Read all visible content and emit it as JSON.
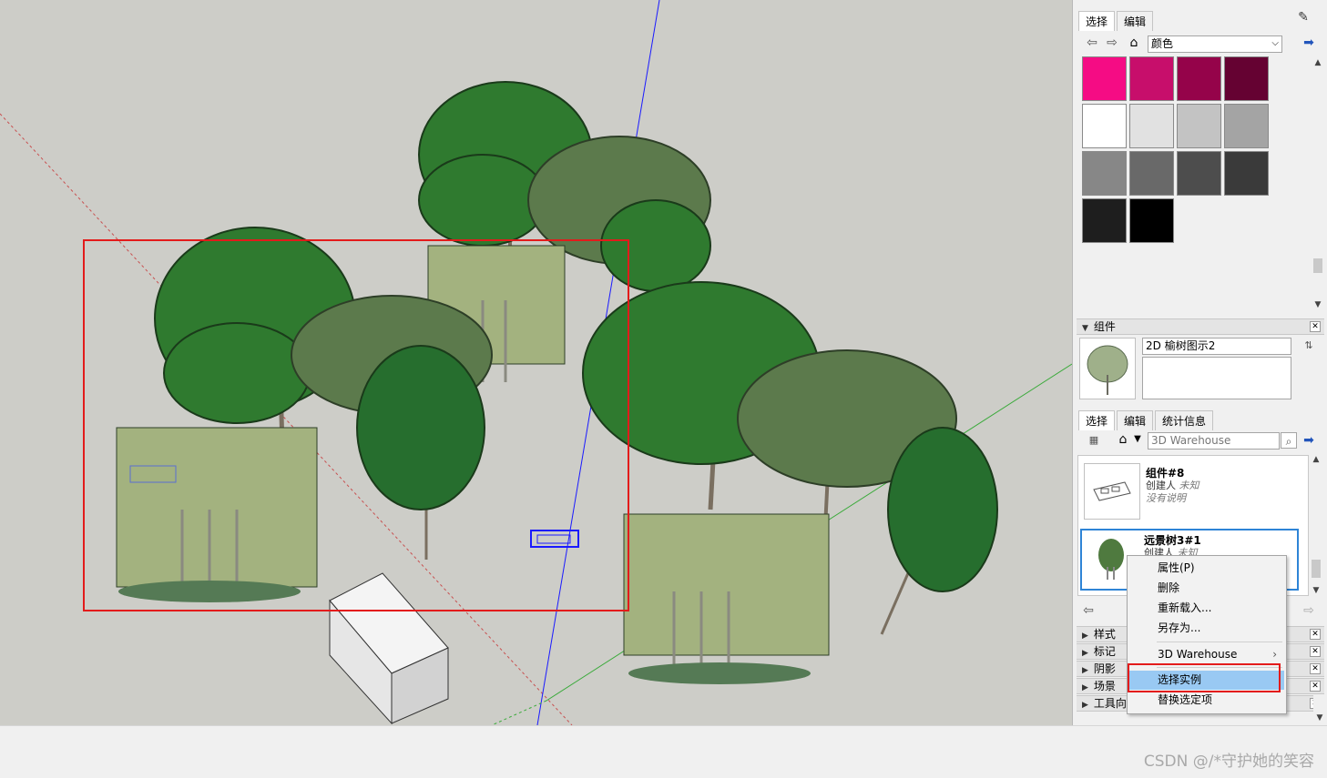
{
  "colors": {
    "viewport_bg": "#cdcdc8",
    "selection_red": "#e31b1b",
    "highlight_blue": "#99c9f3",
    "tree_dark": "#2f7a2f",
    "tree_olive": "#5a7a4a",
    "tree_light": "#8fa46a"
  },
  "materials": {
    "tabs": [
      "选择",
      "编辑"
    ],
    "library": "颜色",
    "swatches": [
      "#f50c84",
      "#c70e6b",
      "#95034a",
      "#650232",
      "#ffffff",
      "#e1e1e1",
      "#c3c3c3",
      "#a4a4a4",
      "#878787",
      "#696969",
      "#4d4d4d",
      "#3a3a3a",
      "#1e1e1e",
      "#000000"
    ]
  },
  "components": {
    "header": "组件",
    "name": "2D 榆树图示2",
    "tabs": [
      "选择",
      "编辑",
      "统计信息"
    ],
    "search_value": "3D Warehouse",
    "items": [
      {
        "title": "组件#8",
        "author_label": "创建人",
        "author": "未知",
        "desc": "没有说明"
      },
      {
        "title": "远景树3#1",
        "author_label": "创建人",
        "author": "未知"
      }
    ]
  },
  "collapsed_panels": [
    "样式",
    "标记",
    "阴影",
    "场景",
    "工具向导"
  ],
  "context_menu": {
    "items": [
      "属性(P)",
      "删除",
      "重新载入...",
      "另存为...",
      "3D Warehouse",
      "选择实例",
      "替换选定项"
    ],
    "selected": "选择实例"
  },
  "watermark": "CSDN @/*守护她的笑容"
}
